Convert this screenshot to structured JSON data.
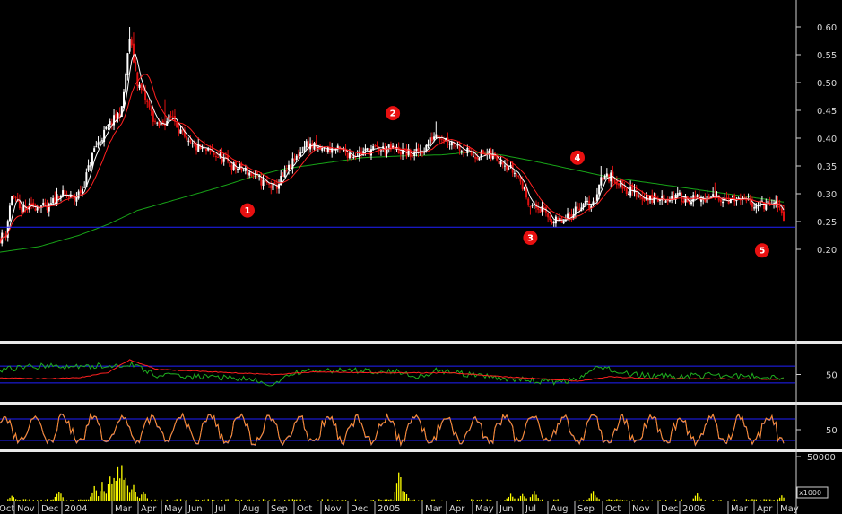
{
  "chart_data": [
    {
      "type": "line",
      "panel": "price",
      "chart_style": "candlestick with moving averages",
      "x_labels": [
        "Oct",
        "Nov",
        "Dec",
        "2004",
        "Mar",
        "Apr",
        "May",
        "Jun",
        "Jul",
        "Aug",
        "Sep",
        "Oct",
        "Nov",
        "Dec",
        "2005",
        "Mar",
        "Apr",
        "May",
        "Jun",
        "Jul",
        "Aug",
        "Sep",
        "Oct",
        "Nov",
        "Dec",
        "2006",
        "Mar",
        "Apr",
        "May"
      ],
      "y_ticks": [
        "0.60",
        "0.55",
        "0.50",
        "0.45",
        "0.40",
        "0.35",
        "0.30",
        "0.25",
        "0.20"
      ],
      "ylim": [
        0.155,
        0.63
      ],
      "grid": false,
      "colors": {
        "up": "#ffffff",
        "down": "#e01010",
        "ma_fast": "#ffffff",
        "ma_mid": "#ff2020",
        "ma_long": "#17a317",
        "support": "#2020ff",
        "marker": "#e81010"
      },
      "series": [
        {
          "role": "close",
          "anchors": [
            [
              0,
              0.22
            ],
            [
              3,
              0.23
            ],
            [
              6,
              0.3
            ],
            [
              10,
              0.27
            ],
            [
              20,
              0.28
            ],
            [
              24,
              0.27
            ],
            [
              30,
              0.3
            ],
            [
              38,
              0.29
            ],
            [
              42,
              0.31
            ],
            [
              48,
              0.38
            ],
            [
              55,
              0.42
            ],
            [
              62,
              0.45
            ],
            [
              66,
              0.58
            ],
            [
              70,
              0.5
            ],
            [
              74,
              0.47
            ],
            [
              80,
              0.42
            ],
            [
              88,
              0.44
            ],
            [
              95,
              0.39
            ],
            [
              102,
              0.38
            ],
            [
              110,
              0.37
            ],
            [
              118,
              0.35
            ],
            [
              126,
              0.34
            ],
            [
              134,
              0.32
            ],
            [
              140,
              0.31
            ],
            [
              146,
              0.34
            ],
            [
              150,
              0.36
            ],
            [
              156,
              0.39
            ],
            [
              162,
              0.38
            ],
            [
              170,
              0.38
            ],
            [
              180,
              0.37
            ],
            [
              190,
              0.38
            ],
            [
              200,
              0.38
            ],
            [
              210,
              0.37
            ],
            [
              216,
              0.38
            ],
            [
              222,
              0.41
            ],
            [
              226,
              0.4
            ],
            [
              232,
              0.39
            ],
            [
              240,
              0.37
            ],
            [
              248,
              0.37
            ],
            [
              256,
              0.36
            ],
            [
              264,
              0.33
            ],
            [
              270,
              0.28
            ],
            [
              276,
              0.27
            ],
            [
              282,
              0.25
            ],
            [
              288,
              0.25
            ],
            [
              292,
              0.27
            ],
            [
              296,
              0.28
            ],
            [
              302,
              0.28
            ],
            [
              306,
              0.33
            ],
            [
              312,
              0.33
            ],
            [
              318,
              0.31
            ],
            [
              324,
              0.3
            ],
            [
              330,
              0.29
            ],
            [
              336,
              0.29
            ],
            [
              344,
              0.295
            ],
            [
              352,
              0.29
            ],
            [
              360,
              0.29
            ],
            [
              366,
              0.295
            ],
            [
              372,
              0.29
            ],
            [
              380,
              0.285
            ],
            [
              388,
              0.28
            ],
            [
              395,
              0.28
            ],
            [
              399,
              0.26
            ]
          ]
        },
        {
          "role": "ma_long",
          "anchors": [
            [
              0,
              0.195
            ],
            [
              20,
              0.205
            ],
            [
              40,
              0.225
            ],
            [
              55,
              0.245
            ],
            [
              70,
              0.27
            ],
            [
              90,
              0.29
            ],
            [
              110,
              0.31
            ],
            [
              128,
              0.33
            ],
            [
              145,
              0.345
            ],
            [
              165,
              0.355
            ],
            [
              185,
              0.365
            ],
            [
              205,
              0.368
            ],
            [
              225,
              0.37
            ],
            [
              240,
              0.375
            ],
            [
              255,
              0.37
            ],
            [
              270,
              0.36
            ],
            [
              290,
              0.345
            ],
            [
              310,
              0.33
            ],
            [
              330,
              0.32
            ],
            [
              350,
              0.31
            ],
            [
              370,
              0.3
            ],
            [
              390,
              0.29
            ],
            [
              399,
              0.285
            ]
          ]
        },
        {
          "role": "support",
          "level": 0.24
        }
      ],
      "annotations": [
        "1",
        "2",
        "3",
        "4",
        "5"
      ]
    },
    {
      "type": "line",
      "panel": "oscillator-1",
      "y_ticks": [
        "50"
      ],
      "reference_lines": [
        70,
        30
      ],
      "series": [
        {
          "role": "green_oscillator",
          "base_anchors": [
            [
              0,
              62
            ],
            [
              20,
              70
            ],
            [
              40,
              68
            ],
            [
              60,
              72
            ],
            [
              66,
              75
            ],
            [
              80,
              48
            ],
            [
              100,
              45
            ],
            [
              120,
              42
            ],
            [
              135,
              30
            ],
            [
              140,
              26
            ],
            [
              150,
              55
            ],
            [
              170,
              60
            ],
            [
              200,
              58
            ],
            [
              215,
              45
            ],
            [
              222,
              60
            ],
            [
              240,
              48
            ],
            [
              260,
              40
            ],
            [
              280,
              32
            ],
            [
              295,
              38
            ],
            [
              305,
              70
            ],
            [
              320,
              50
            ],
            [
              340,
              45
            ],
            [
              360,
              48
            ],
            [
              380,
              46
            ],
            [
              399,
              44
            ]
          ]
        },
        {
          "role": "red_signal",
          "base_anchors": [
            [
              0,
              42
            ],
            [
              20,
              40
            ],
            [
              40,
              42
            ],
            [
              55,
              55
            ],
            [
              66,
              85
            ],
            [
              80,
              62
            ],
            [
              100,
              58
            ],
            [
              120,
              54
            ],
            [
              140,
              50
            ],
            [
              160,
              56
            ],
            [
              200,
              54
            ],
            [
              230,
              54
            ],
            [
              255,
              45
            ],
            [
              275,
              40
            ],
            [
              295,
              34
            ],
            [
              310,
              45
            ],
            [
              330,
              40
            ],
            [
              360,
              40
            ],
            [
              399,
              39
            ]
          ]
        }
      ]
    },
    {
      "type": "line",
      "panel": "oscillator-2",
      "y_ticks": [
        "50"
      ],
      "reference_lines": [
        80,
        20
      ],
      "series": [
        {
          "role": "orange_oscillator",
          "cycle": "oscillating between about 5 and 95"
        }
      ]
    },
    {
      "type": "bar",
      "panel": "volume",
      "y_ticks": [
        "50000"
      ],
      "unit_label": "x1000",
      "series": [
        {
          "role": "volume",
          "color": "#ffff00",
          "peaks": [
            [
              6,
              6000
            ],
            [
              30,
              14000
            ],
            [
              48,
              18000
            ],
            [
              52,
              22000
            ],
            [
              56,
              32000
            ],
            [
              58,
              26000
            ],
            [
              60,
              42000
            ],
            [
              62,
              48000
            ],
            [
              64,
              30000
            ],
            [
              68,
              20000
            ],
            [
              73,
              12000
            ],
            [
              203,
              44000
            ],
            [
              206,
              12000
            ],
            [
              260,
              8000
            ],
            [
              266,
              9000
            ],
            [
              272,
              14000
            ],
            [
              302,
              12000
            ],
            [
              355,
              9000
            ],
            [
              398,
              6000
            ]
          ]
        }
      ]
    }
  ]
}
